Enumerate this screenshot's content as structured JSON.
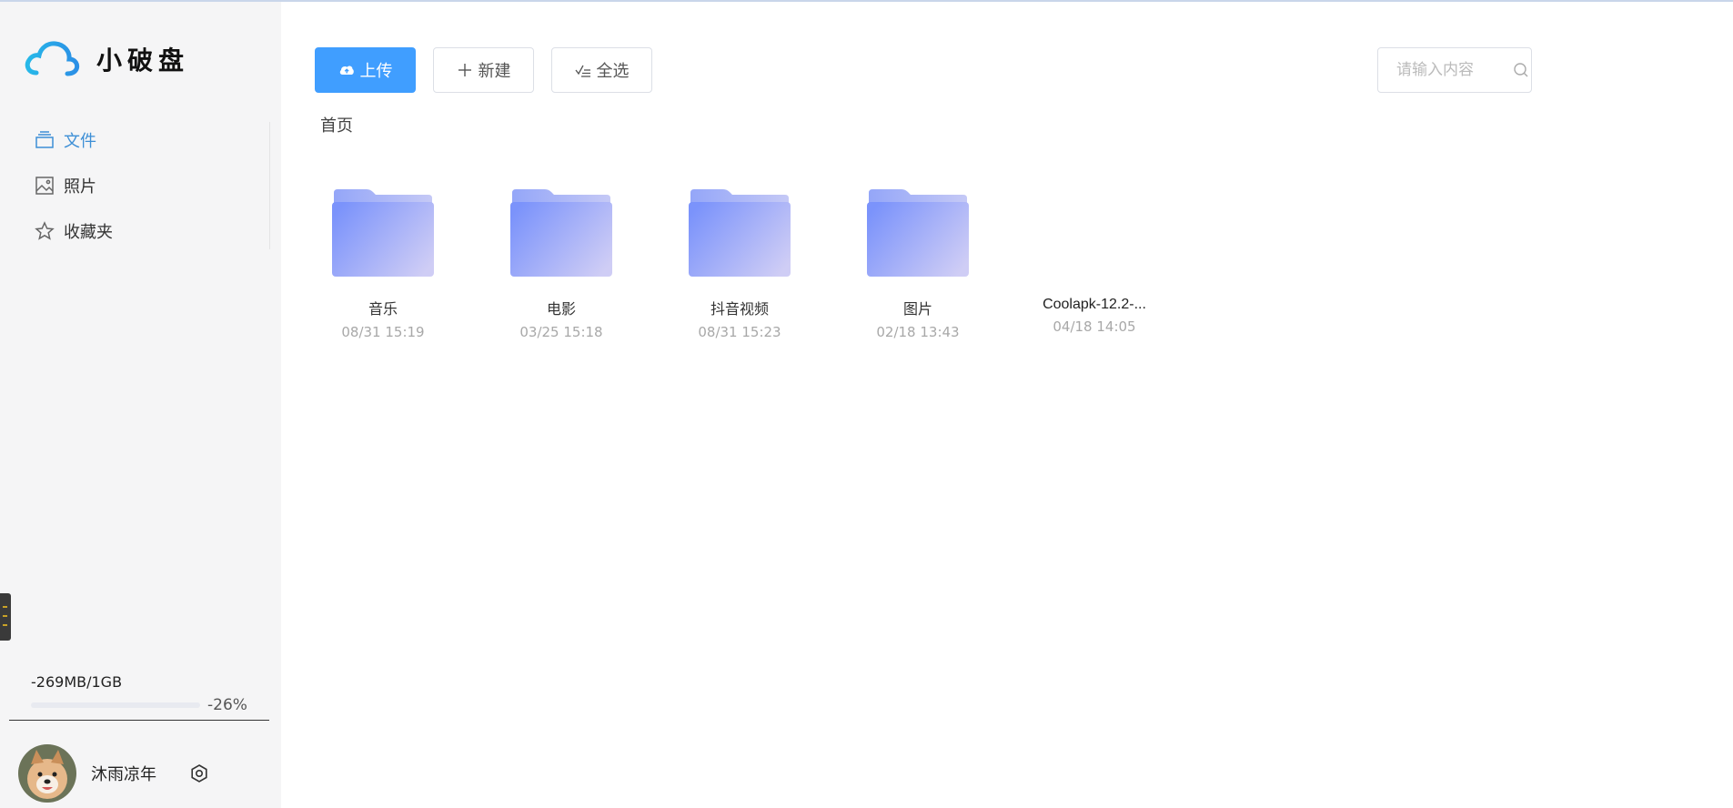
{
  "app": {
    "name": "小破盘"
  },
  "sidebar": {
    "items": [
      {
        "label": "文件",
        "icon": "files-icon",
        "active": true
      },
      {
        "label": "照片",
        "icon": "image-icon",
        "active": false
      },
      {
        "label": "收藏夹",
        "icon": "star-icon",
        "active": false
      }
    ],
    "storage": {
      "text": "-269MB/1GB",
      "percent": "-26%",
      "fill": 0
    },
    "user": {
      "name": "沐雨凉年"
    }
  },
  "toolbar": {
    "upload_label": "上传",
    "new_label": "新建",
    "select_all_label": "全选"
  },
  "search": {
    "placeholder": "请输入内容"
  },
  "breadcrumb": {
    "home": "首页"
  },
  "files": [
    {
      "name": "音乐",
      "date": "08/31 15:19",
      "type": "folder"
    },
    {
      "name": "电影",
      "date": "03/25 15:18",
      "type": "folder"
    },
    {
      "name": "抖音视频",
      "date": "08/31 15:23",
      "type": "folder"
    },
    {
      "name": "图片",
      "date": "02/18 13:43",
      "type": "folder"
    },
    {
      "name": "Coolapk-12.2-...",
      "date": "04/18 14:05",
      "type": "file"
    }
  ],
  "colors": {
    "accent": "#409eff",
    "active_nav": "#3d8fd6",
    "folder_start": "#7b93fb",
    "folder_end": "#cfcdf5"
  }
}
